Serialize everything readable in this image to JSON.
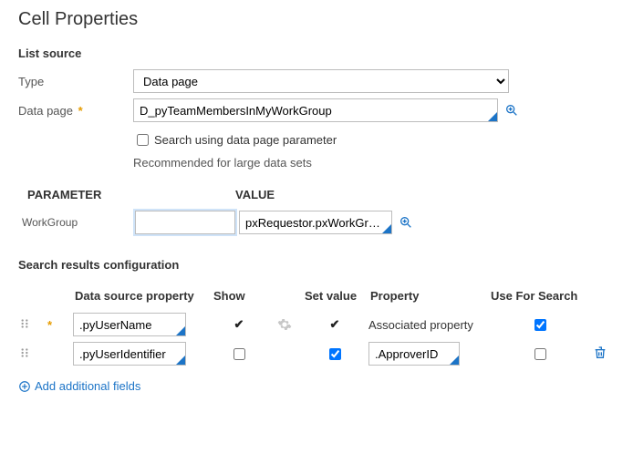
{
  "title": "Cell Properties",
  "listSource": {
    "heading": "List source",
    "typeLabel": "Type",
    "typeValue": "Data page",
    "dataPageLabel": "Data page",
    "dataPageValue": "D_pyTeamMembersInMyWorkGroup",
    "searchParamLabel": "Search using data page parameter",
    "searchParamChecked": false,
    "recommended": "Recommended for large data sets"
  },
  "paramHeaders": {
    "parameter": "PARAMETER",
    "value": "VALUE"
  },
  "paramRow": {
    "name": "WorkGroup",
    "input": "",
    "value": "pxRequestor.pxWorkGroup"
  },
  "results": {
    "heading": "Search results configuration",
    "headers": {
      "dataSource": "Data source property",
      "show": "Show",
      "setValue": "Set value",
      "property": "Property",
      "useForSearch": "Use For Search"
    },
    "rows": [
      {
        "required": true,
        "dataSource": ".pyUserName",
        "showLocked": true,
        "showGear": true,
        "setValueLocked": true,
        "propertyText": "Associated property",
        "propertyField": "",
        "useForSearch": true,
        "deletable": false
      },
      {
        "required": false,
        "dataSource": ".pyUserIdentifier",
        "showLocked": false,
        "showGear": false,
        "setValueLocked": false,
        "setValueChecked": true,
        "propertyText": "",
        "propertyField": ".ApproverID",
        "useForSearch": false,
        "deletable": true
      }
    ],
    "addLink": "Add additional fields"
  }
}
